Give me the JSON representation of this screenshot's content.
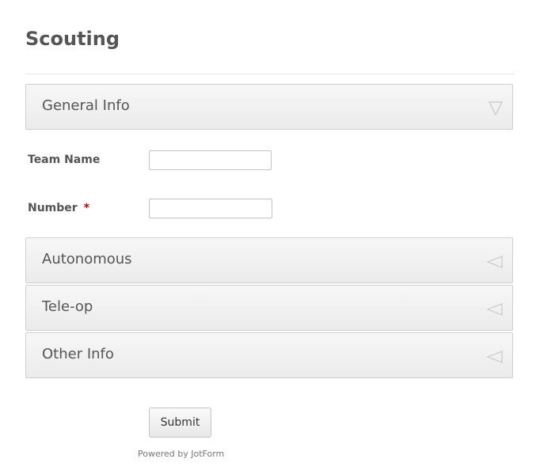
{
  "form": {
    "title": "Scouting"
  },
  "sections": [
    {
      "label": "General Info",
      "state": "expanded",
      "arrow_icon": "triangle-down-icon"
    },
    {
      "label": "Autonomous",
      "state": "collapsed",
      "arrow_icon": "triangle-left-icon"
    },
    {
      "label": "Tele-op",
      "state": "collapsed",
      "arrow_icon": "triangle-left-icon"
    },
    {
      "label": "Other Info",
      "state": "collapsed",
      "arrow_icon": "triangle-left-icon"
    }
  ],
  "fields": {
    "team_name": {
      "label": "Team Name",
      "value": "",
      "placeholder": ""
    },
    "number": {
      "label": "Number",
      "required_mark": "*",
      "value": "",
      "placeholder": ""
    }
  },
  "submit": {
    "label": "Submit"
  },
  "footer": {
    "powered_by_prefix": "Powered by ",
    "powered_by_link": "JotForm"
  },
  "colors": {
    "text": "#555555",
    "required": "#cc0000",
    "section_border": "#d0d0d0",
    "section_bg_top": "#f7f7f7",
    "section_bg_bottom": "#ebebeb",
    "arrow": "#c8c8c8"
  }
}
